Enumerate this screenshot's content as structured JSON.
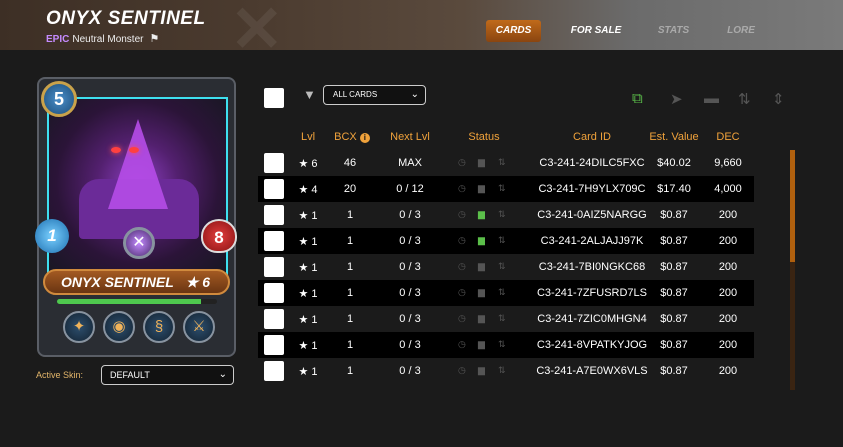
{
  "header": {
    "title": "ONYX SENTINEL",
    "rarity": "EPIC",
    "subtitle": "Neutral Monster",
    "tabs": [
      {
        "label": "CARDS",
        "active": true
      },
      {
        "label": "FOR SALE",
        "active": false
      },
      {
        "label": "STATS",
        "active": false
      },
      {
        "label": "LORE",
        "active": false
      }
    ]
  },
  "card": {
    "mana": "5",
    "speed": "1",
    "health": "8",
    "name": "ONYX SENTINEL",
    "level": "★ 6",
    "xp_fraction": 0.9,
    "abilities": [
      "shield-ability-icon",
      "magic-ability-icon",
      "dragon-ability-icon",
      "sword-ability-icon"
    ]
  },
  "skin": {
    "label": "Active Skin:",
    "value": "DEFAULT"
  },
  "filter": {
    "value": "ALL CARDS"
  },
  "table": {
    "columns": [
      "Lvl",
      "BCX",
      "Next Lvl",
      "Status",
      "Card ID",
      "Est. Value",
      "DEC"
    ],
    "rows": [
      {
        "lvl": "★ 6",
        "bcx": "46",
        "next": "MAX",
        "id": "C3-241-24DILC5FXC",
        "value": "$40.02",
        "dec": "9,660",
        "rented": false
      },
      {
        "lvl": "★ 4",
        "bcx": "20",
        "next": "0 / 12",
        "id": "C3-241-7H9YLX709C",
        "value": "$17.40",
        "dec": "4,000",
        "rented": false
      },
      {
        "lvl": "★ 1",
        "bcx": "1",
        "next": "0 / 3",
        "id": "C3-241-0AIZ5NARGG",
        "value": "$0.87",
        "dec": "200",
        "rented": true
      },
      {
        "lvl": "★ 1",
        "bcx": "1",
        "next": "0 / 3",
        "id": "C3-241-2ALJAJJ97K",
        "value": "$0.87",
        "dec": "200",
        "rented": true
      },
      {
        "lvl": "★ 1",
        "bcx": "1",
        "next": "0 / 3",
        "id": "C3-241-7BI0NGKC68",
        "value": "$0.87",
        "dec": "200",
        "rented": false
      },
      {
        "lvl": "★ 1",
        "bcx": "1",
        "next": "0 / 3",
        "id": "C3-241-7ZFUSRD7LS",
        "value": "$0.87",
        "dec": "200",
        "rented": false
      },
      {
        "lvl": "★ 1",
        "bcx": "1",
        "next": "0 / 3",
        "id": "C3-241-7ZIC0MHGN4",
        "value": "$0.87",
        "dec": "200",
        "rented": false
      },
      {
        "lvl": "★ 1",
        "bcx": "1",
        "next": "0 / 3",
        "id": "C3-241-8VPATKYJOG",
        "value": "$0.87",
        "dec": "200",
        "rented": false
      },
      {
        "lvl": "★ 1",
        "bcx": "1",
        "next": "0 / 3",
        "id": "C3-241-A7E0WX6VLS",
        "value": "$0.87",
        "dec": "200",
        "rented": false
      }
    ]
  },
  "colors": {
    "accent": "#f0a23b",
    "active_tab": "#c06a1a",
    "enabled_action": "#5bbf4a",
    "scrollbar": "#b0600e"
  }
}
